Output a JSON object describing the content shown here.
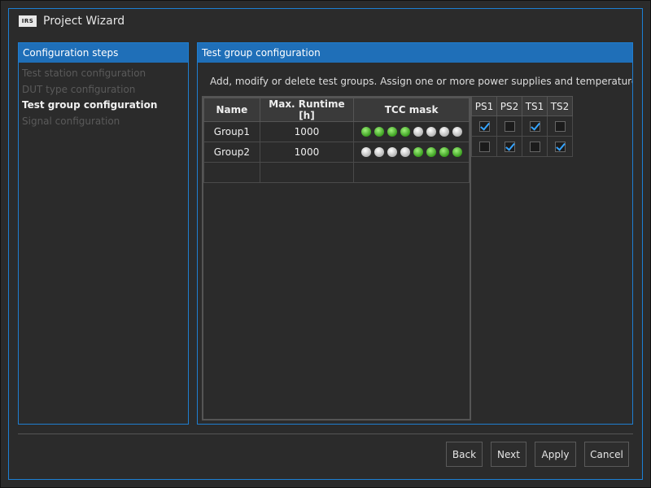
{
  "window": {
    "title": "Project Wizard",
    "logo_text": "IRS"
  },
  "steps": {
    "header": "Configuration steps",
    "items": [
      {
        "label": "Test station configuration",
        "state": "disabled"
      },
      {
        "label": "DUT type configuration",
        "state": "disabled"
      },
      {
        "label": "Test group configuration",
        "state": "active"
      },
      {
        "label": "Signal configuration",
        "state": "disabled"
      }
    ]
  },
  "config": {
    "header": "Test group configuration",
    "instructions": "Add, modify or delete test groups. Assign one or more power supplies and temperature sensors",
    "columns": {
      "name": "Name",
      "runtime": "Max. Runtime [h]",
      "tcc": "TCC mask"
    },
    "assign_columns": [
      "PS1",
      "PS2",
      "TS1",
      "TS2"
    ],
    "rows": [
      {
        "name": "Group1",
        "runtime": "1000",
        "tcc": [
          1,
          1,
          1,
          1,
          0,
          0,
          0,
          0
        ],
        "assign": [
          true,
          false,
          true,
          false
        ]
      },
      {
        "name": "Group2",
        "runtime": "1000",
        "tcc": [
          0,
          0,
          0,
          0,
          1,
          1,
          1,
          1
        ],
        "assign": [
          false,
          true,
          false,
          true
        ]
      }
    ],
    "led_colors": {
      "on": "#4caf22",
      "off": "#d0d0d0"
    }
  },
  "buttons": {
    "back": "Back",
    "next": "Next",
    "apply": "Apply",
    "cancel": "Cancel"
  },
  "colors": {
    "accent": "#1f6fb8",
    "background": "#2b2b2b",
    "check": "#35a4ff"
  }
}
